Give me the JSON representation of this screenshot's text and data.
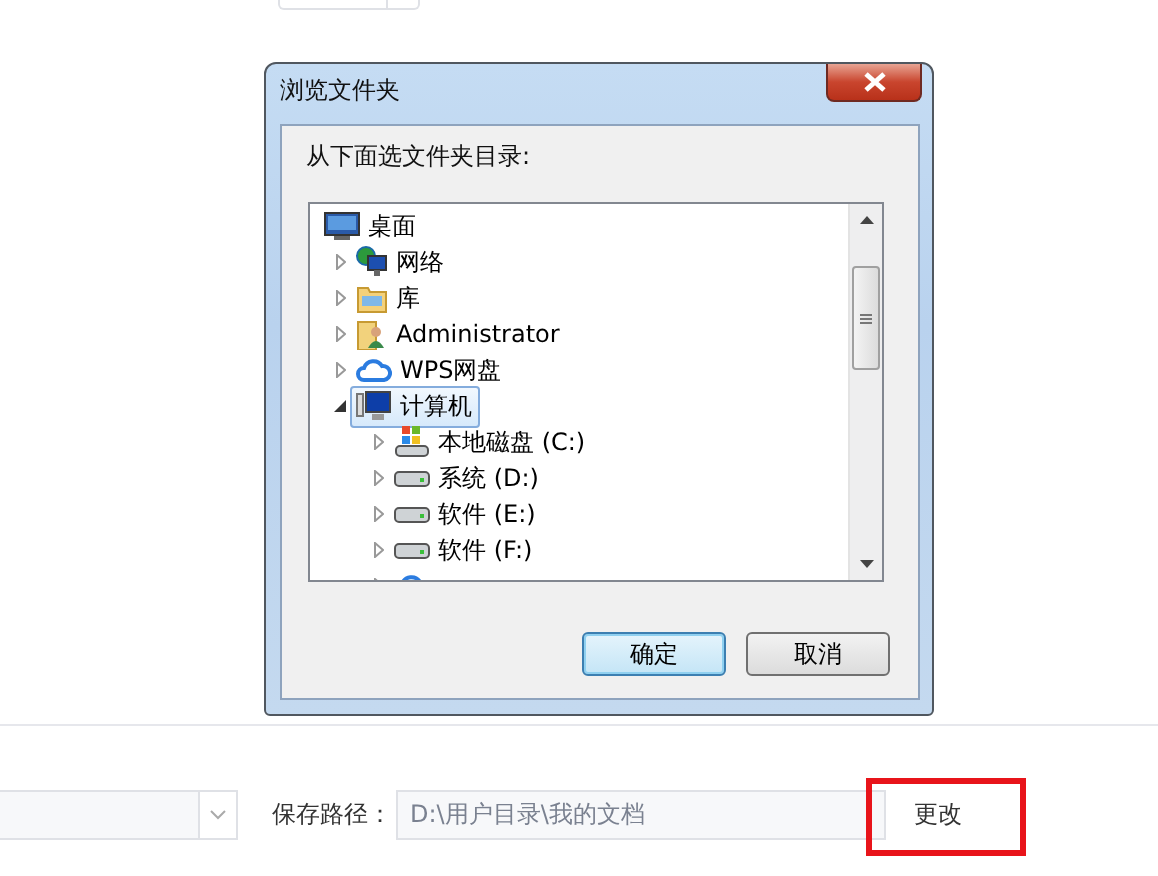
{
  "dialog": {
    "title": "浏览文件夹",
    "prompt": "从下面选文件夹目录:",
    "tree": [
      {
        "label": "桌面",
        "kind": "desktop",
        "selected": false,
        "children": [
          {
            "label": "网络",
            "kind": "network",
            "expanded": false,
            "selected": false
          },
          {
            "label": "库",
            "kind": "library",
            "expanded": false,
            "selected": false
          },
          {
            "label": "Administrator",
            "kind": "user",
            "expanded": false,
            "selected": false
          },
          {
            "label": "WPS网盘",
            "kind": "cloud",
            "expanded": false,
            "selected": false
          },
          {
            "label": "计算机",
            "kind": "computer",
            "expanded": true,
            "selected": true,
            "children": [
              {
                "label": "本地磁盘 (C:)",
                "kind": "system-drive",
                "expanded": false,
                "selected": false
              },
              {
                "label": "系统 (D:)",
                "kind": "drive",
                "expanded": false,
                "selected": false
              },
              {
                "label": "软件 (E:)",
                "kind": "drive",
                "expanded": false,
                "selected": false
              },
              {
                "label": "软件 (F:)",
                "kind": "drive",
                "expanded": false,
                "selected": false
              },
              {
                "kind": "cloud",
                "expanded": false,
                "selected": false
              }
            ]
          }
        ]
      }
    ],
    "buttons": [
      {
        "label": "确定",
        "default": true
      },
      {
        "label": "取消",
        "default": false
      }
    ]
  },
  "save_path": {
    "label": "保存路径：",
    "value": "D:\\用户目录\\我的文档",
    "button": "更改",
    "highlighted": true
  }
}
